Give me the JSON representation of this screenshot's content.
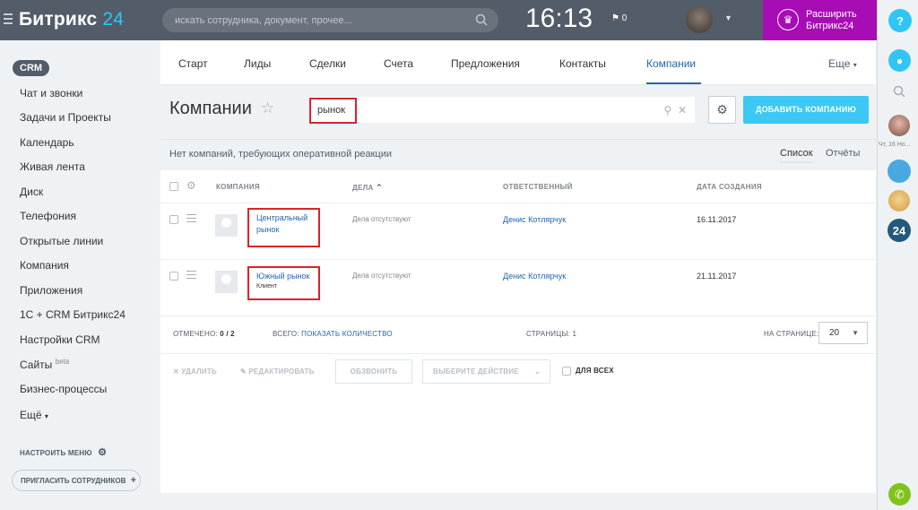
{
  "top": {
    "logo": "Битрикс",
    "logo_num": "24",
    "search_placeholder": "искать сотрудника, документ, прочее...",
    "clock": "16:13",
    "flag_count": "0",
    "upgrade_line1": "Расширить",
    "upgrade_line2": "Битрикс24"
  },
  "right_panel": {
    "help": "?",
    "date": "Чт, 16 Но...",
    "logo24": "24"
  },
  "sidebar": {
    "crm": "CRM",
    "items": [
      "Чат и звонки",
      "Задачи и Проекты",
      "Календарь",
      "Живая лента",
      "Диск",
      "Телефония",
      "Открытые линии",
      "Компания",
      "Приложения",
      "1С + CRM Битрикс24",
      "Настройки CRM",
      "Сайты",
      "Бизнес-процессы",
      "Ещё"
    ],
    "beta": "beta",
    "configure": "НАСТРОИТЬ МЕНЮ",
    "invite": "ПРИГЛАСИТЬ СОТРУДНИКОВ"
  },
  "tabs": [
    "Старт",
    "Лиды",
    "Сделки",
    "Счета",
    "Предложения",
    "Контакты",
    "Компании"
  ],
  "more": "Еще",
  "page_title": "Компании",
  "filter_chip": "рынок",
  "add_company": "ДОБАВИТЬ КОМПАНИЮ",
  "notice": "Нет компаний, требующих оперативной реакции",
  "view_list": "Список",
  "view_reports": "Отчёты",
  "grid": {
    "headers": [
      "КОМПАНИЯ",
      "ДЕЛА",
      "ОТВЕТСТВЕННЫЙ",
      "ДАТА СОЗДАНИЯ"
    ],
    "rows": [
      {
        "name": "Центральный рынок",
        "type": "",
        "deals": "Дела отсутствуют",
        "responsible": "Денис Котлярчук",
        "date": "16.11.2017"
      },
      {
        "name": "Южный рынок",
        "type": "Клиент",
        "deals": "Дела отсутствуют",
        "responsible": "Денис Котлярчук",
        "date": "21.11.2017"
      }
    ]
  },
  "footer": {
    "marked_label": "ОТМЕЧЕНО:",
    "marked_value": "0 / 2",
    "total_label": "ВСЕГО:",
    "show_count": "ПОКАЗАТЬ КОЛИЧЕСТВО",
    "pages_label": "СТРАНИЦЫ:",
    "pages_value": "1",
    "per_page_label": "НА СТРАНИЦЕ:",
    "per_page_value": "20"
  },
  "actions": {
    "delete": "УДАЛИТЬ",
    "edit": "РЕДАКТИРОВАТЬ",
    "call": "ОБЗВОНИТЬ",
    "choose": "ВЫБЕРИТЕ ДЕЙСТВИЕ",
    "for_all": "ДЛЯ ВСЕХ"
  },
  "colors": {
    "topbar": "#535c69",
    "accent": "#2fc6f6",
    "upgrade": "#a80cb5",
    "link": "#2067b0",
    "highlight": "#d9232b"
  }
}
